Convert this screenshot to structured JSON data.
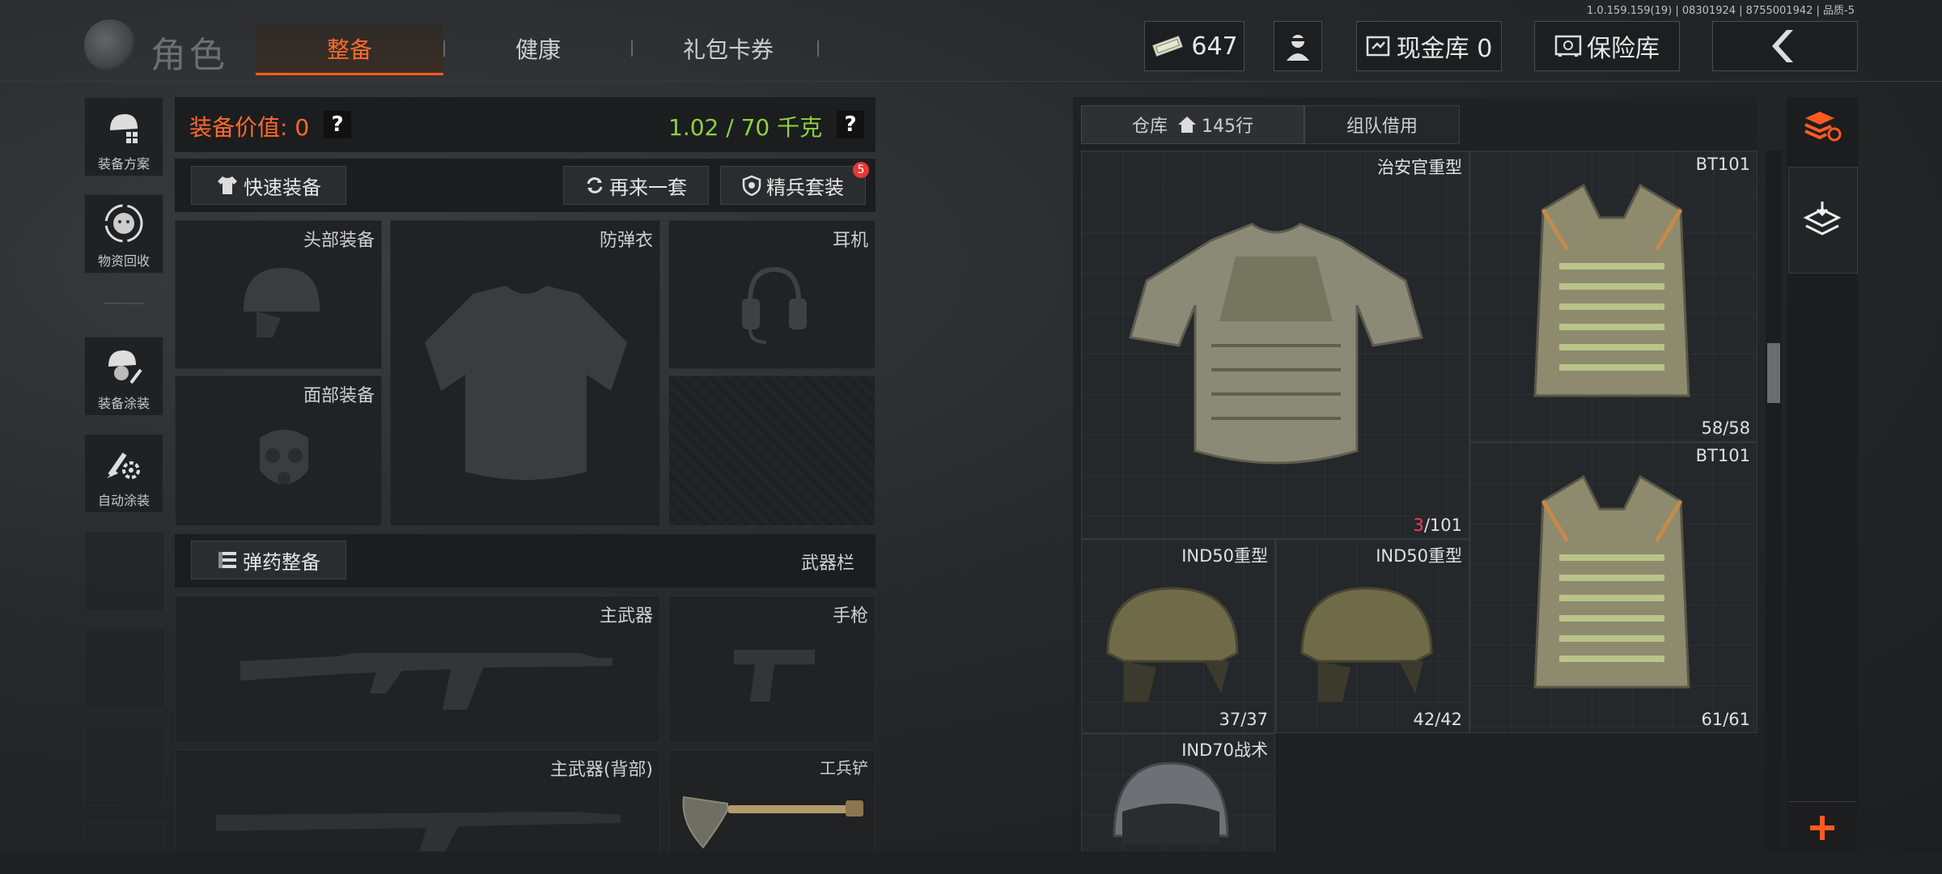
{
  "version_text": "1.0.159.159(19) | 08301924 | 8755001942 | 品质-5",
  "header": {
    "title": "角色",
    "tabs": [
      {
        "label": "整备",
        "active": true
      },
      {
        "label": "健康",
        "active": false
      },
      {
        "label": "礼包卡券",
        "active": false
      }
    ],
    "currency": "647",
    "cash_vault": "现金库 0",
    "safe_box": "保险库"
  },
  "sidebar": {
    "items": [
      {
        "label": "装备方案",
        "icon": "helmet-grid-icon"
      },
      {
        "label": "物资回收",
        "icon": "recycle-face-icon"
      },
      {
        "label": "装备涂装",
        "icon": "helmet-brush-icon"
      },
      {
        "label": "自动涂装",
        "icon": "brush-gear-icon"
      }
    ]
  },
  "equipment": {
    "value_label": "装备价值: 0",
    "weight": "1.02 / 70 千克",
    "quick_equip": "快速装备",
    "repeat_set": "再来一套",
    "elite_set": "精兵套装",
    "elite_badge": "5",
    "slots": {
      "head": "头部装备",
      "armor": "防弹衣",
      "headset": "耳机",
      "face": "面部装备",
      "primary": "主武器",
      "pistol": "手枪",
      "primary_back": "主武器(背部)",
      "shovel": "工兵铲"
    },
    "ammo_button": "弹药整备",
    "weapon_bar": "武器栏"
  },
  "warehouse": {
    "tab_storage": "仓库",
    "tab_storage_rows": "145行",
    "tab_team": "组队借用",
    "items": [
      {
        "name": "治安官重型",
        "count_red": "3",
        "count_rest": "/101"
      },
      {
        "name": "BT101",
        "count": "58/58"
      },
      {
        "name": "BT101",
        "count": "61/61"
      },
      {
        "name": "IND50重型",
        "count": "37/37"
      },
      {
        "name": "IND50重型",
        "count": "42/42"
      },
      {
        "name": "IND70战术",
        "count": ""
      }
    ]
  },
  "colors": {
    "accent": "#ff5a1f",
    "weight_green": "#8fd13f",
    "value_orange": "#ff6a2c",
    "count_red": "#ff3b5c"
  }
}
